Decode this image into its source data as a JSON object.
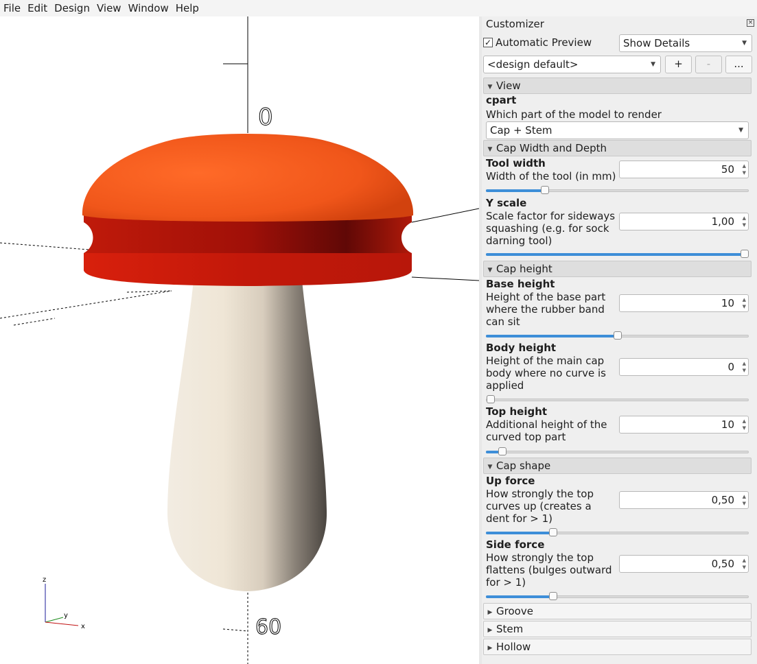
{
  "menu": [
    "File",
    "Edit",
    "Design",
    "View",
    "Window",
    "Help"
  ],
  "viewport": {
    "axis_labels": [
      "0",
      "60"
    ],
    "gizmo": {
      "z": "z",
      "y": "y",
      "x": "x"
    },
    "colors": {
      "cap_top": "#f05a1a",
      "cap_groove": "#b81408",
      "stem": "#efe6d6"
    }
  },
  "customizer": {
    "title": "Customizer",
    "automatic_preview": {
      "label": "Automatic Preview",
      "checked": true,
      "mark": "✓"
    },
    "details_combo": "Show Details",
    "preset_combo": "<design default>",
    "buttons": {
      "add": "+",
      "remove": "-",
      "more": "..."
    },
    "groups": [
      {
        "title": "View",
        "expanded": true
      },
      {
        "title": "Cap Width and Depth",
        "expanded": true
      },
      {
        "title": "Cap height",
        "expanded": true
      },
      {
        "title": "Cap shape",
        "expanded": true
      },
      {
        "title": "Groove",
        "expanded": false
      },
      {
        "title": "Stem",
        "expanded": false
      },
      {
        "title": "Hollow",
        "expanded": false
      }
    ],
    "params": {
      "cpart": {
        "name": "cpart",
        "desc": "Which part of the model to render",
        "value": "Cap + Stem"
      },
      "tool_width": {
        "name": "Tool width",
        "desc": "Width of the tool (in mm)",
        "value": "50",
        "slider": 0.23
      },
      "y_scale": {
        "name": "Y scale",
        "desc": "Scale factor for sideways squashing (e.g. for sock darning tool)",
        "value": "1,00",
        "slider": 1.0
      },
      "base_height": {
        "name": "Base height",
        "desc": "Height of the base part where the rubber band can sit",
        "value": "10",
        "slider": 0.5
      },
      "body_height": {
        "name": "Body height",
        "desc": "Height of the main cap body where no curve is applied",
        "value": "0",
        "slider": 0.0
      },
      "top_height": {
        "name": "Top height",
        "desc": "Additional height of the curved top part",
        "value": "10",
        "slider": 0.05
      },
      "up_force": {
        "name": "Up force",
        "desc": "How strongly the top curves up (creates a dent for > 1)",
        "value": "0,50",
        "slider": 0.26
      },
      "side_force": {
        "name": "Side force",
        "desc": "How strongly the top flattens (bulges outward for > 1)",
        "value": "0,50",
        "slider": 0.26
      }
    }
  }
}
